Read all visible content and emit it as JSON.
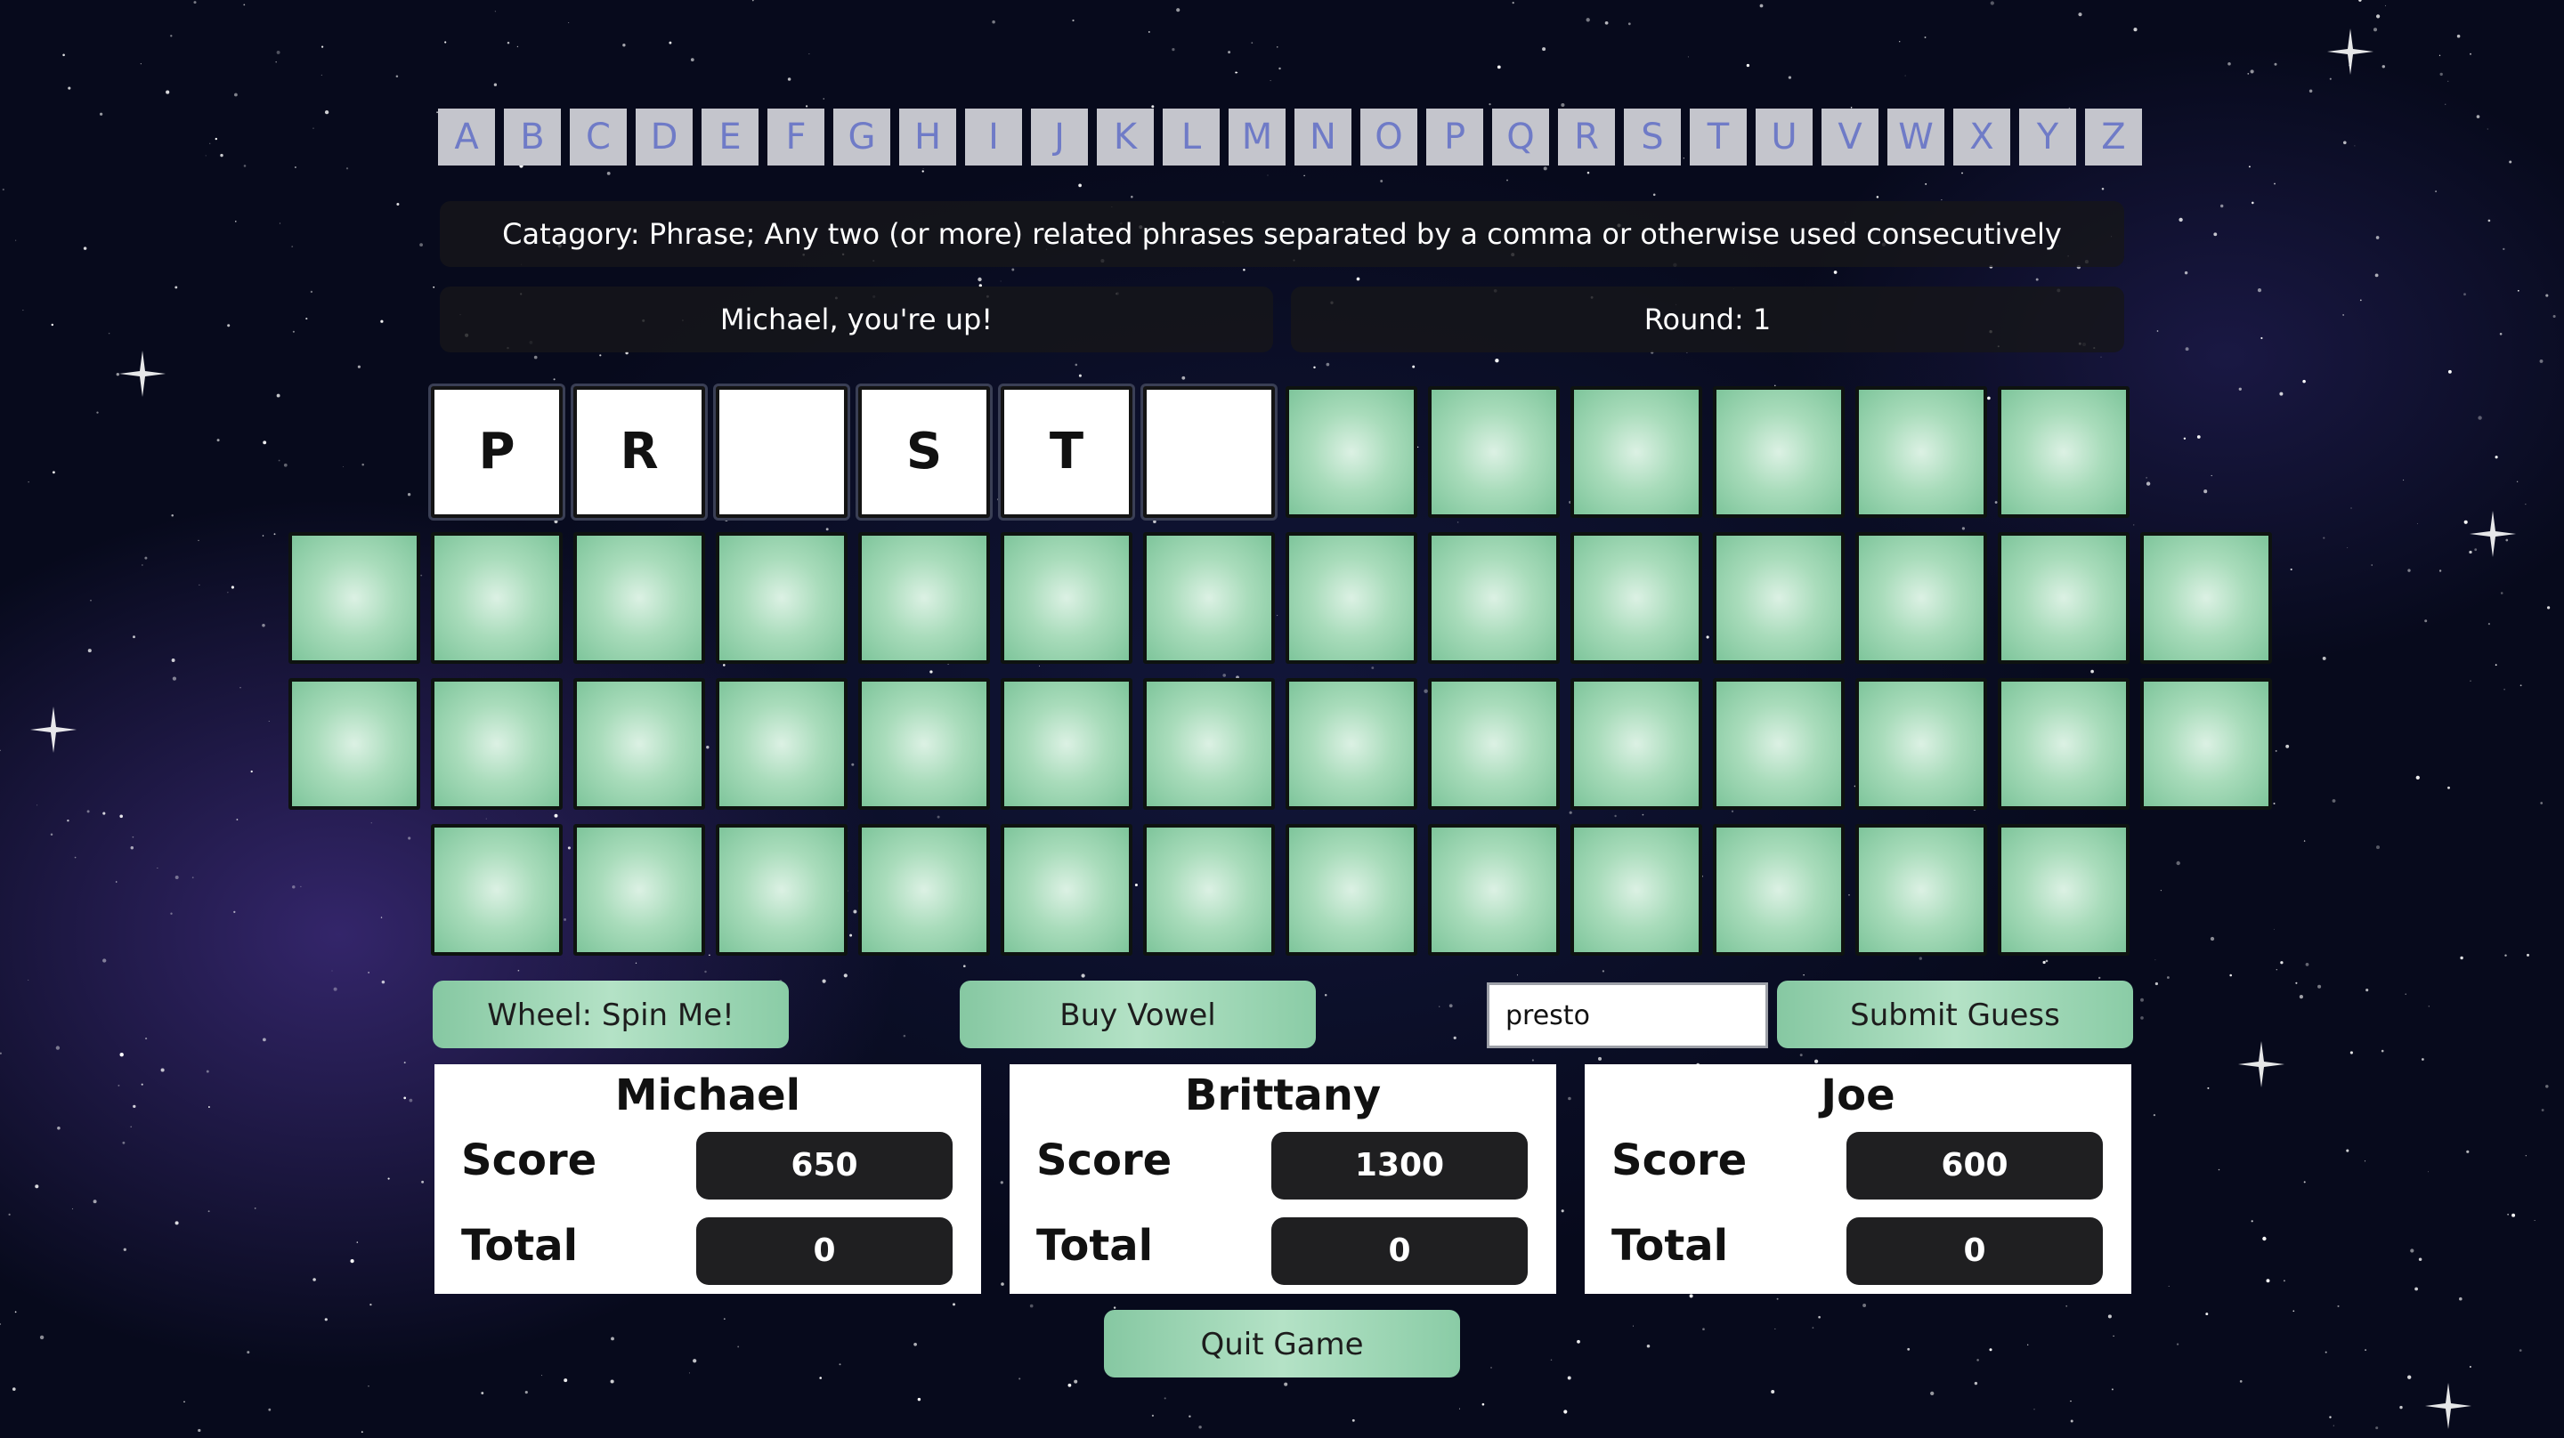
{
  "letters": [
    "A",
    "B",
    "C",
    "D",
    "E",
    "F",
    "G",
    "H",
    "I",
    "J",
    "K",
    "L",
    "M",
    "N",
    "O",
    "P",
    "Q",
    "R",
    "S",
    "T",
    "U",
    "V",
    "W",
    "X",
    "Y",
    "Z"
  ],
  "category": "Catagory: Phrase; Any two (or more) related phrases separated by a comma or otherwise used consecutively",
  "turn_text": "Michael, you're up!",
  "round_text": "Round: 1",
  "board": {
    "row1": [
      "P",
      "R",
      "",
      "S",
      "T",
      "",
      null,
      null,
      null,
      null,
      null,
      null
    ],
    "row2": [
      null,
      null,
      null,
      null,
      null,
      null,
      null,
      null,
      null,
      null,
      null,
      null,
      null,
      null
    ],
    "row3": [
      null,
      null,
      null,
      null,
      null,
      null,
      null,
      null,
      null,
      null,
      null,
      null,
      null,
      null
    ],
    "row4": [
      null,
      null,
      null,
      null,
      null,
      null,
      null,
      null,
      null,
      null,
      null,
      null
    ]
  },
  "controls": {
    "spin_label": "Wheel: Spin Me!",
    "vowel_label": "Buy Vowel",
    "guess_value": "presto",
    "submit_label": "Submit Guess",
    "quit_label": "Quit Game"
  },
  "players": [
    {
      "name": "Michael",
      "score_label": "Score",
      "score": "650",
      "total_label": "Total",
      "total": "0"
    },
    {
      "name": "Brittany",
      "score_label": "Score",
      "score": "1300",
      "total_label": "Total",
      "total": "0"
    },
    {
      "name": "Joe",
      "score_label": "Score",
      "score": "600",
      "total_label": "Total",
      "total": "0"
    }
  ],
  "colors": {
    "tile_hidden": "#a9dcbb",
    "button": "#9fd6b6",
    "letter_bg": "#c4c5cc",
    "letter_text": "#6f7bc7",
    "info_bar": "#16161a",
    "score_box": "#1f1f21"
  }
}
